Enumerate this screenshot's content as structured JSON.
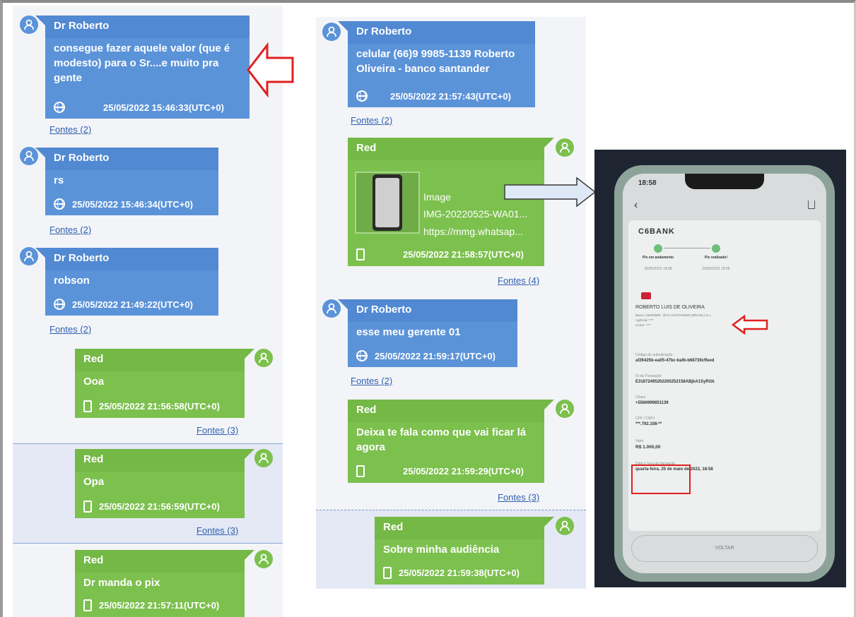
{
  "col1": {
    "m1": {
      "sender": "Dr Roberto",
      "text": "consegue fazer aquele valor (que é modesto) para o Sr....e muito pra gente",
      "time": "25/05/2022 15:46:33(UTC+0)"
    },
    "f1": "Fontes (2)",
    "m2": {
      "sender": "Dr Roberto",
      "text": "rs",
      "time": "25/05/2022 15:46:34(UTC+0)"
    },
    "f2": "Fontes (2)",
    "m3": {
      "sender": "Dr Roberto",
      "text": "robson",
      "time": "25/05/2022 21:49:22(UTC+0)"
    },
    "f3": "Fontes (2)",
    "m4": {
      "sender": "Red",
      "text": "Ooa",
      "time": "25/05/2022 21:56:58(UTC+0)"
    },
    "f4": "Fontes (3)",
    "m5": {
      "sender": "Red",
      "text": "Opa",
      "time": "25/05/2022 21:56:59(UTC+0)"
    },
    "f5": "Fontes (3)",
    "m6": {
      "sender": "Red",
      "text": "Dr manda o pix",
      "time": "25/05/2022 21:57:11(UTC+0)"
    }
  },
  "col2": {
    "m1": {
      "sender": "Dr Roberto",
      "text": "celular (66)9 9985-1139 Roberto Oliveira - banco santander",
      "time": "25/05/2022 21:57:43(UTC+0)"
    },
    "f1": "Fontes (2)",
    "m2": {
      "sender": "Red",
      "att_type": "Image",
      "att_name": "IMG-20220525-WA01...",
      "att_url": "https://mmg.whatsap...",
      "time": "25/05/2022 21:58:57(UTC+0)"
    },
    "f2": "Fontes (4)",
    "m3": {
      "sender": "Dr Roberto",
      "text": "esse meu gerente 01",
      "time": "25/05/2022 21:59:17(UTC+0)"
    },
    "f3": "Fontes (2)",
    "m4": {
      "sender": "Red",
      "text": "Deixa te fala como que vai ficar lá agora",
      "time": "25/05/2022 21:59:29(UTC+0)"
    },
    "f4": "Fontes (3)",
    "m5": {
      "sender": "Red",
      "text": "Sobre minha audiência",
      "time": "25/05/2022 21:59:38(UTC+0)"
    }
  },
  "receipt": {
    "clock": "18:58",
    "bank": "C6BANK",
    "step1": "Pix em andamento",
    "step1_date": "25/05/2022 18:58",
    "step2": "Pix realizado!",
    "step2_date": "25/05/2022 18:58",
    "name": "ROBERTO LUIS DE OLIVEIRA",
    "bank_line": "Banco: 90400888 - BCO SANTANDER (BRASIL) S.A.",
    "agencia": "Agência: ****",
    "conta": "Conta: ****",
    "auth_label": "Código de autenticação",
    "auth_value": "af26425b-ea05-47bc-bafb-b68739cffeed",
    "tx_label": "ID da Transação",
    "tx_value": "E31872495202205252158ABjkA1SyRGk",
    "key_label": "Chave",
    "key_value": "+5566999851139",
    "cpf_label": "CPF / CNPJ",
    "cpf_value": "***.792.108-**",
    "valor_label": "Valor",
    "valor_value": "R$ 1.000,00",
    "date_label": "Data e hora da transação",
    "date_value": "quarta-feira, 25 de maio de 2022, 18:58",
    "button": "VOLTAR"
  },
  "colors": {
    "blue": "#5b93d9",
    "green": "#7cc04e",
    "arrow_red": "#e02020"
  }
}
